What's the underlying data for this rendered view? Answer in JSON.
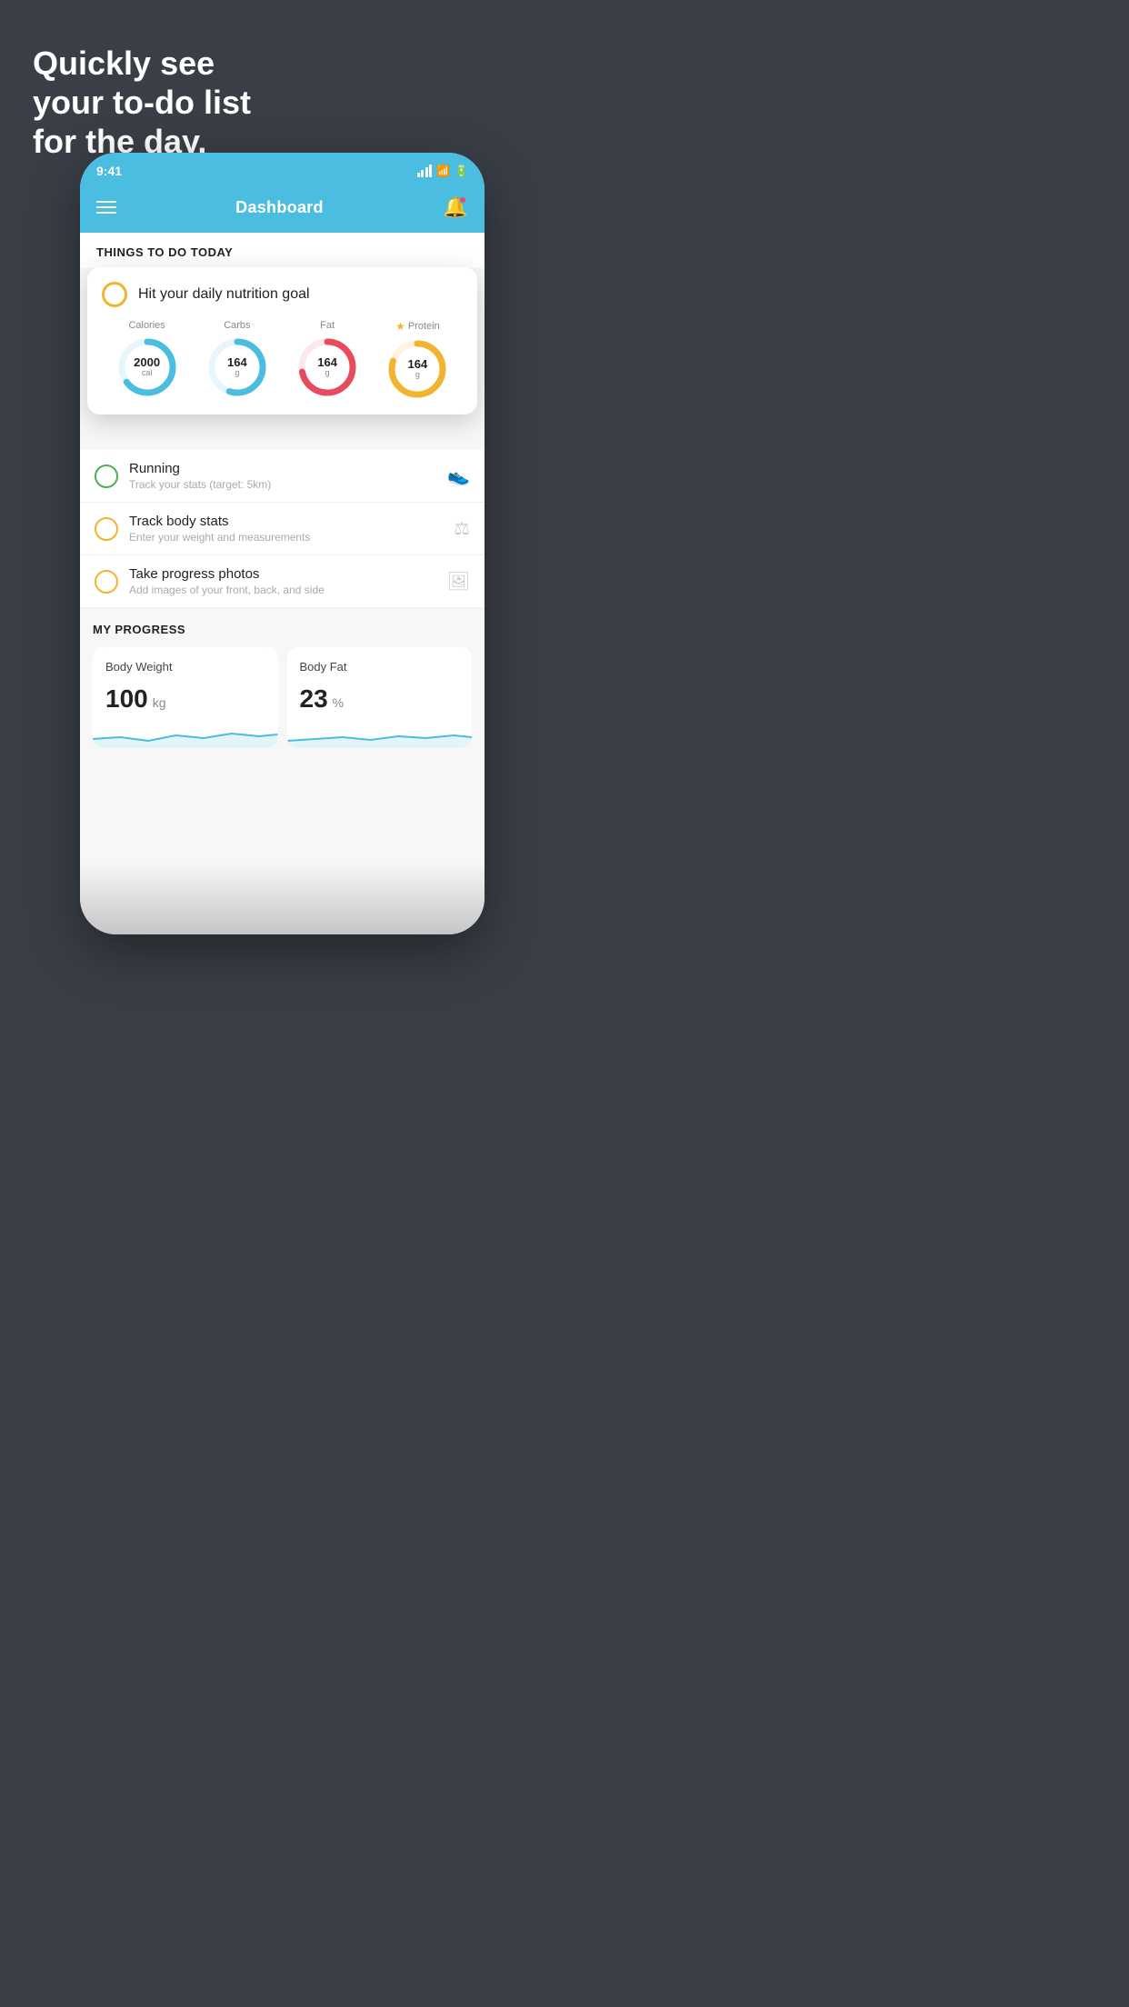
{
  "hero": {
    "line1": "Quickly see",
    "line2": "your to-do list",
    "line3": "for the day."
  },
  "statusBar": {
    "time": "9:41"
  },
  "navBar": {
    "title": "Dashboard"
  },
  "thingsToDo": {
    "header": "THINGS TO DO TODAY"
  },
  "nutritionCard": {
    "title": "Hit your daily nutrition goal",
    "items": [
      {
        "label": "Calories",
        "value": "2000",
        "unit": "cal",
        "color": "#4bbde0",
        "pct": 65
      },
      {
        "label": "Carbs",
        "value": "164",
        "unit": "g",
        "color": "#4bbde0",
        "pct": 55
      },
      {
        "label": "Fat",
        "value": "164",
        "unit": "g",
        "color": "#e84b5c",
        "pct": 72
      },
      {
        "label": "Protein",
        "value": "164",
        "unit": "g",
        "color": "#f0b430",
        "pct": 80,
        "star": true
      }
    ]
  },
  "todoItems": [
    {
      "title": "Running",
      "subtitle": "Track your stats (target: 5km)",
      "circleColor": "green",
      "icon": "👟"
    },
    {
      "title": "Track body stats",
      "subtitle": "Enter your weight and measurements",
      "circleColor": "yellow",
      "icon": "⚖"
    },
    {
      "title": "Take progress photos",
      "subtitle": "Add images of your front, back, and side",
      "circleColor": "yellow",
      "icon": "🖼"
    }
  ],
  "progressSection": {
    "header": "MY PROGRESS",
    "cards": [
      {
        "title": "Body Weight",
        "value": "100",
        "unit": "kg"
      },
      {
        "title": "Body Fat",
        "value": "23",
        "unit": "%"
      }
    ]
  }
}
